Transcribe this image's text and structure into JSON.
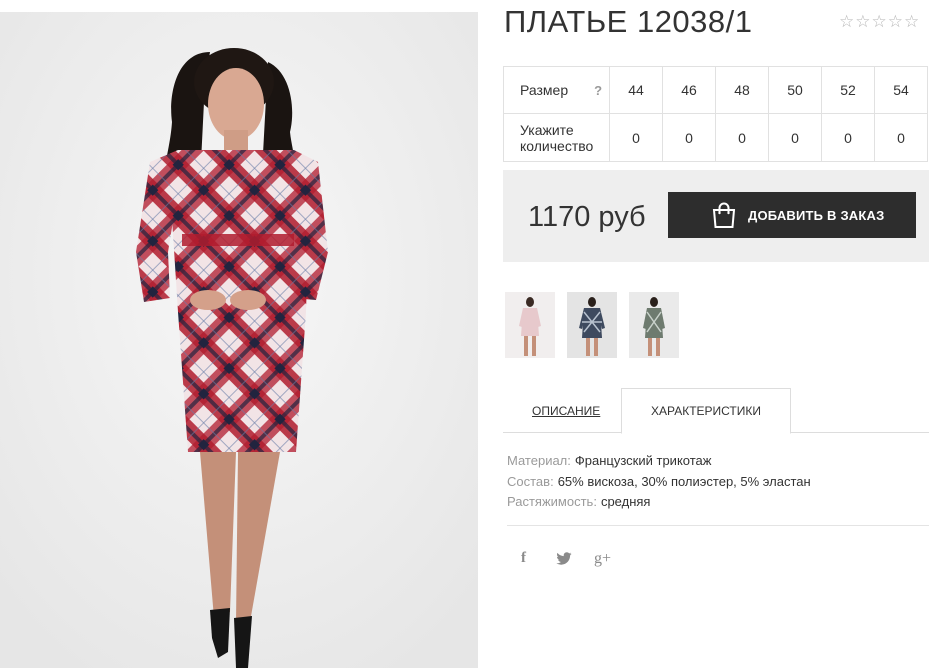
{
  "product": {
    "title": "ПЛАТЬЕ 12038/1",
    "rating_stars": "☆☆☆☆☆",
    "image_icon": "product-photo-woman-plaid-dress"
  },
  "size_table": {
    "size_label": "Размер",
    "help": "?",
    "sizes": [
      "44",
      "46",
      "48",
      "50",
      "52",
      "54"
    ],
    "quantity_label_1": "Укажите",
    "quantity_label_2": "количество",
    "quantities": [
      "0",
      "0",
      "0",
      "0",
      "0",
      "0"
    ]
  },
  "order": {
    "price": "1170 руб",
    "add_button": "ДОБАВИТЬ В ЗАКАЗ",
    "button_icon": "shopping-bag-icon"
  },
  "thumbnails": [
    "color-pink",
    "color-navy",
    "color-grey"
  ],
  "tabs": {
    "description": "ОПИСАНИЕ",
    "characteristics": "ХАРАКТЕРИСТИКИ"
  },
  "characteristics": [
    {
      "key": "Материал:",
      "value": "Французский трикотаж"
    },
    {
      "key": "Состав:",
      "value": "65% вискоза, 30% полиэстер, 5% эластан"
    },
    {
      "key": "Растяжимость:",
      "value": "средняя"
    }
  ],
  "social": {
    "facebook": "f",
    "twitter": "twitter-bird",
    "google_plus": "g+"
  },
  "colors": {
    "button": "#2d2d2d",
    "order_box": "#eeeeee",
    "dress_red": "#b01c2e",
    "dress_navy": "#22243f"
  }
}
